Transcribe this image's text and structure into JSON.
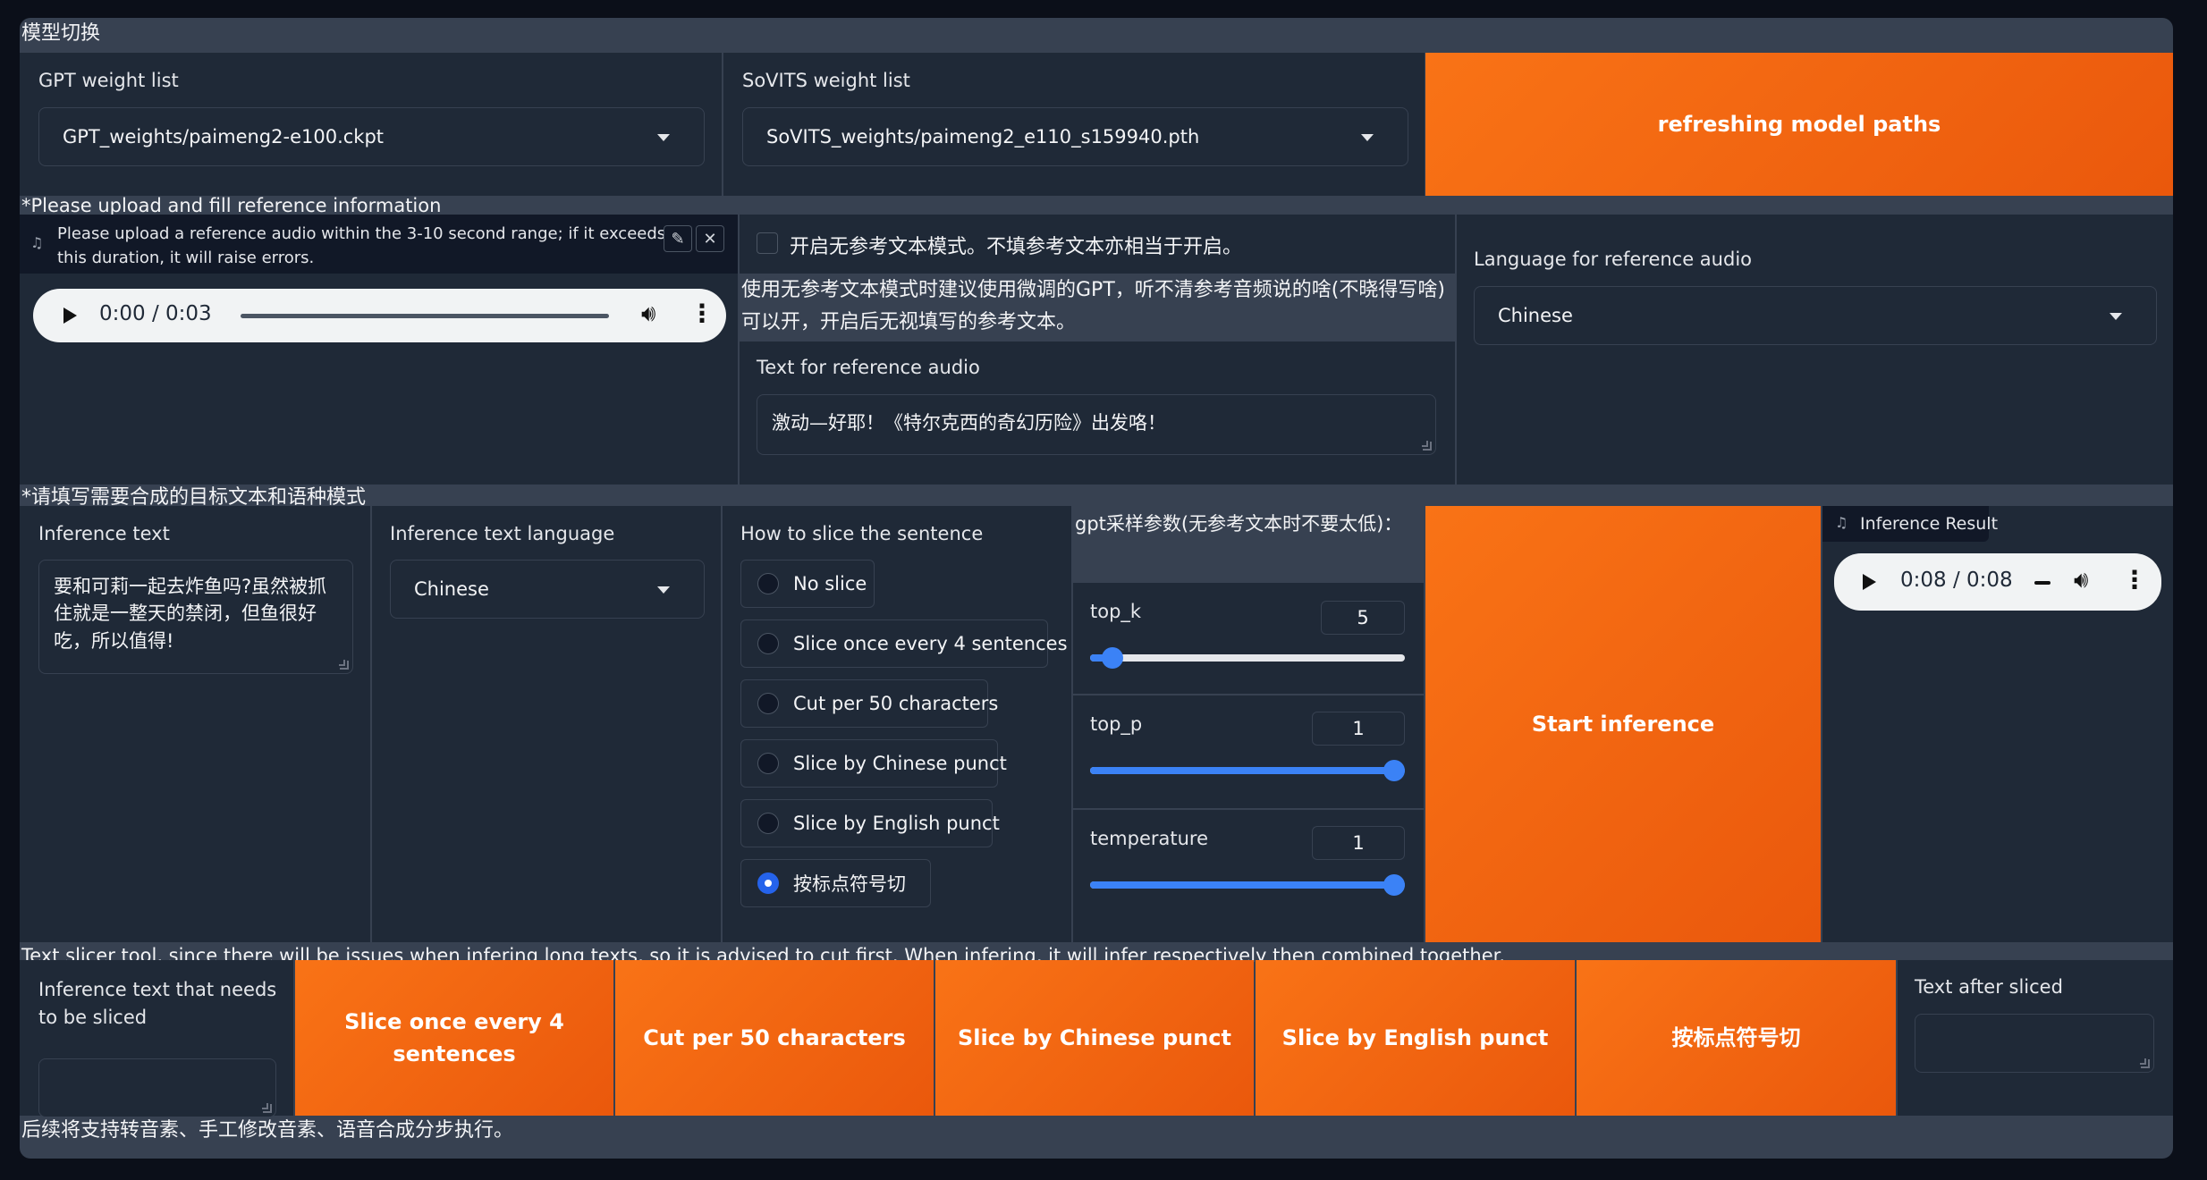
{
  "model_switch": {
    "section_title": "模型切换",
    "gpt_label": "GPT weight list",
    "gpt_value": "GPT_weights/paimeng2-e100.ckpt",
    "sovits_label": "SoVITS weight list",
    "sovits_value": "SoVITS_weights/paimeng2_e110_s159940.pth",
    "refresh_button": "refreshing model paths"
  },
  "reference": {
    "section_title": "*Please upload and fill reference information",
    "audio_hint": "Please upload a reference audio within the 3-10 second range; if it exceeds this duration, it will raise errors.",
    "audio_time": "0:00 / 0:03",
    "audio_progress": 0,
    "no_ref_checkbox_label": "开启无参考文本模式。不填参考文本亦相当于开启。",
    "no_ref_checked": false,
    "no_ref_note": "使用无参考文本模式时建议使用微调的GPT，听不清参考音频说的啥(不晓得写啥)可以开，开启后无视填写的参考文本。",
    "ref_text_label": "Text for reference audio",
    "ref_text_value": "激动—好耶！《特尔克西的奇幻历险》出发咯！",
    "ref_lang_label": "Language for reference audio",
    "ref_lang_value": "Chinese"
  },
  "target": {
    "section_title": "*请填写需要合成的目标文本和语种模式",
    "inference_text_label": "Inference text",
    "inference_text_value": "要和可莉一起去炸鱼吗?虽然被抓住就是一整天的禁闭，但鱼很好吃，所以值得!",
    "inference_lang_label": "Inference text language",
    "inference_lang_value": "Chinese",
    "slice_label": "How to slice the sentence",
    "slice_options": [
      {
        "label": "No slice",
        "selected": false
      },
      {
        "label": "Slice once every 4 sentences",
        "selected": false
      },
      {
        "label": "Cut per 50 characters",
        "selected": false
      },
      {
        "label": "Slice by Chinese punct",
        "selected": false
      },
      {
        "label": "Slice by English punct",
        "selected": false
      },
      {
        "label": "按标点符号切",
        "selected": true
      }
    ],
    "gpt_params_label": "gpt采样参数(无参考文本时不要太低)：",
    "top_k": {
      "label": "top_k",
      "value": "5",
      "fraction": 0.07
    },
    "top_p": {
      "label": "top_p",
      "value": "1",
      "fraction": 1.0
    },
    "temperature": {
      "label": "temperature",
      "value": "1",
      "fraction": 1.0
    },
    "start_button": "Start inference",
    "result_label": "Inference Result",
    "result_time": "0:08 / 0:08"
  },
  "slicer": {
    "section_title": "Text slicer tool, since there will be issues when infering long texts, so it is advised to cut first. When infering, it will infer respectively then combined together.",
    "input_label": "Inference text that needs to be sliced",
    "buttons": [
      "Slice once every 4 sentences",
      "Cut per 50 characters",
      "Slice by Chinese punct",
      "Slice by English punct",
      "按标点符号切"
    ],
    "output_label": "Text after sliced"
  },
  "footer_note": "后续将支持转音素、手工修改音素、语音合成分步执行。"
}
